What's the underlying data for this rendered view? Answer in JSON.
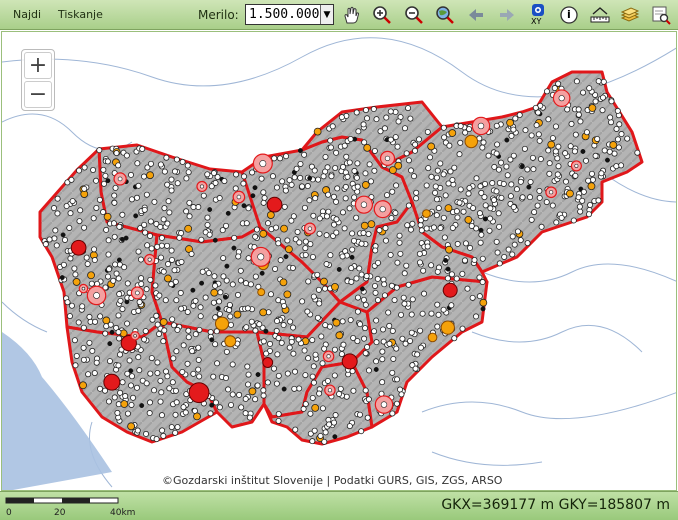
{
  "toolbar": {
    "menu": [
      "Najdi",
      "Tiskanje"
    ],
    "scale_label": "Merilo:",
    "scale_value": "1.500.000"
  },
  "tools": [
    {
      "name": "pan-hand-icon"
    },
    {
      "name": "zoom-in-icon"
    },
    {
      "name": "zoom-out-icon"
    },
    {
      "name": "zoom-globe-icon"
    },
    {
      "name": "back-arrow-icon"
    },
    {
      "name": "forward-arrow-icon"
    },
    {
      "name": "xy-coordinate-icon",
      "text": "XY"
    },
    {
      "name": "info-icon",
      "text": "i"
    },
    {
      "name": "measure-icon"
    },
    {
      "name": "layers-icon"
    },
    {
      "name": "search-map-icon"
    }
  ],
  "zoom": {
    "plus": "+",
    "minus": "−"
  },
  "attribution": "©Gozdarski inštitut Slovenije | Podatki GURS, GIS, ZGS, ARSO",
  "statusbar": {
    "coords": "GKX=369177 m GKY=185807 m",
    "scale_ticks": [
      "0",
      "20",
      "40km"
    ]
  },
  "colors": {
    "region_border": "#e0171a",
    "country_fill": "#b8b8b8",
    "point_white": "#ffffff",
    "point_orange": "#f5a20a",
    "point_pink": "#f4a0a0",
    "point_red": "#e31a1c",
    "river": "#9fb6d6",
    "toolbar": "#b5d698"
  }
}
